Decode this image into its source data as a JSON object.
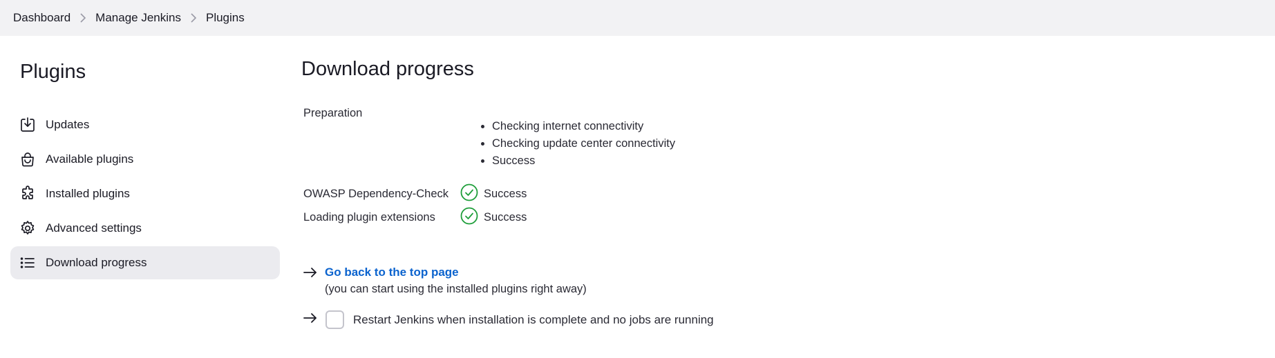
{
  "breadcrumb": {
    "items": [
      "Dashboard",
      "Manage Jenkins",
      "Plugins"
    ]
  },
  "sidebar": {
    "title": "Plugins",
    "items": [
      {
        "label": "Updates",
        "icon": "download-icon"
      },
      {
        "label": "Available plugins",
        "icon": "shopping-bag-icon"
      },
      {
        "label": "Installed plugins",
        "icon": "puzzle-icon"
      },
      {
        "label": "Advanced settings",
        "icon": "gear-icon"
      },
      {
        "label": "Download progress",
        "icon": "list-icon",
        "active": true
      }
    ]
  },
  "main": {
    "title": "Download progress",
    "preparation": {
      "label": "Preparation",
      "steps": [
        "Checking internet connectivity",
        "Checking update center connectivity",
        "Success"
      ]
    },
    "statuses": [
      {
        "name": "OWASP Dependency-Check",
        "status": "Success"
      },
      {
        "name": "Loading plugin extensions",
        "status": "Success"
      }
    ],
    "top_link": "Go back to the top page",
    "top_link_note": "(you can start using the installed plugins right away)",
    "restart_label": "Restart Jenkins when installation is complete and no jobs are running",
    "restart_checked": false
  },
  "colors": {
    "link": "#0b63ce",
    "success": "#1e9e3a",
    "active_bg": "#ebebef",
    "header_bg": "#f2f2f4"
  }
}
